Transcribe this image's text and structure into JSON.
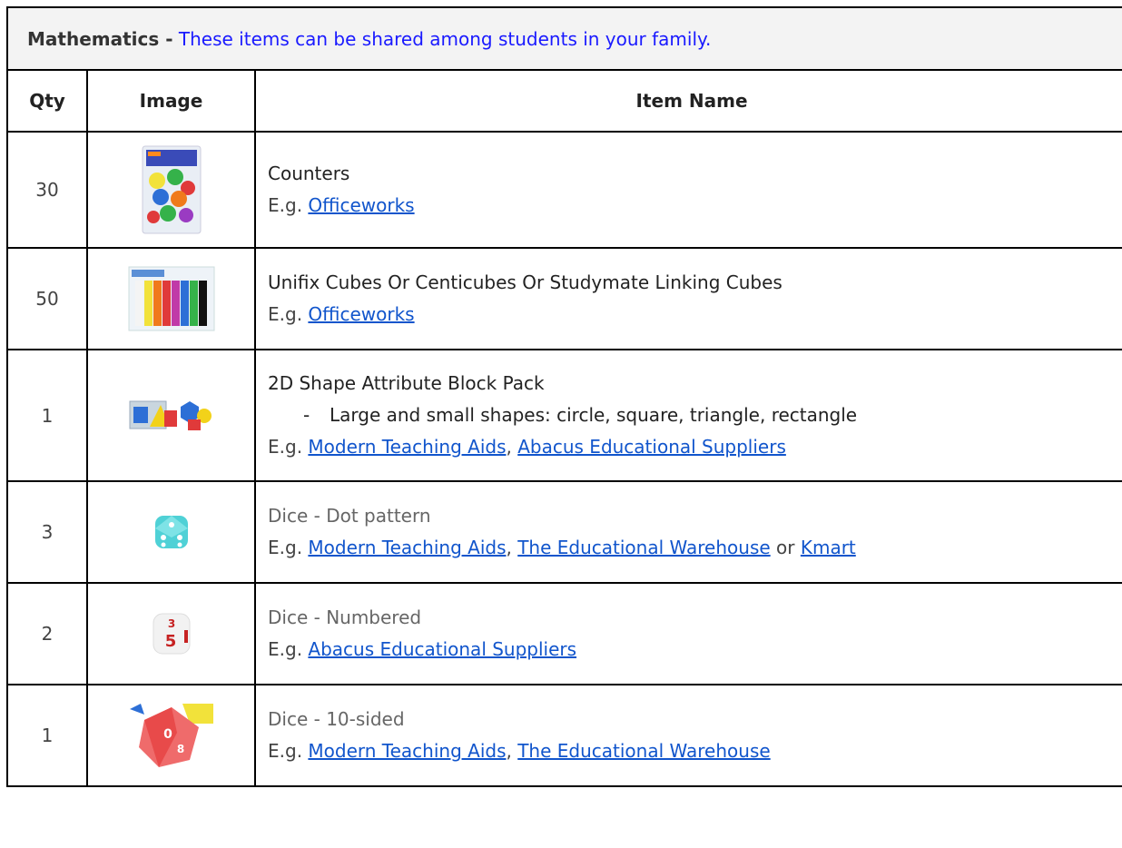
{
  "title": {
    "bold": "Mathematics -",
    "note": "These items can be shared among students in your family."
  },
  "headers": {
    "qty": "Qty",
    "image": "Image",
    "name": "Item Name"
  },
  "rows": [
    {
      "qty": "30",
      "name": "Counters",
      "eg": "E.g.",
      "links": [
        "Officeworks"
      ],
      "image_icon": "counters-pack-icon"
    },
    {
      "qty": "50",
      "name": "Unifix Cubes Or Centicubes Or Studymate Linking Cubes",
      "eg": "E.g.",
      "links": [
        "Officeworks"
      ],
      "image_icon": "linking-cubes-icon"
    },
    {
      "qty": "1",
      "name": "2D Shape Attribute Block Pack",
      "bullet_dash": "-",
      "bullet": "Large and small shapes: circle, square, triangle, rectangle",
      "eg": "E.g.",
      "links": [
        "Modern Teaching Aids",
        "Abacus Educational Suppliers"
      ],
      "sep": ",",
      "image_icon": "attribute-blocks-icon"
    },
    {
      "qty": "3",
      "name": "Dice - Dot pattern",
      "eg": "E.g.",
      "links": [
        "Modern Teaching Aids",
        "The Educational Warehouse",
        "Kmart"
      ],
      "sep": ",",
      "or": "or",
      "image_icon": "dot-dice-icon"
    },
    {
      "qty": "2",
      "name": "Dice - Numbered",
      "eg": "E.g.",
      "links": [
        "Abacus Educational Suppliers"
      ],
      "image_icon": "numbered-dice-icon"
    },
    {
      "qty": "1",
      "name": "Dice - 10-sided",
      "eg": "E.g.",
      "links": [
        "Modern Teaching Aids",
        "The Educational Warehouse"
      ],
      "sep": ",",
      "image_icon": "ten-sided-dice-icon"
    }
  ]
}
